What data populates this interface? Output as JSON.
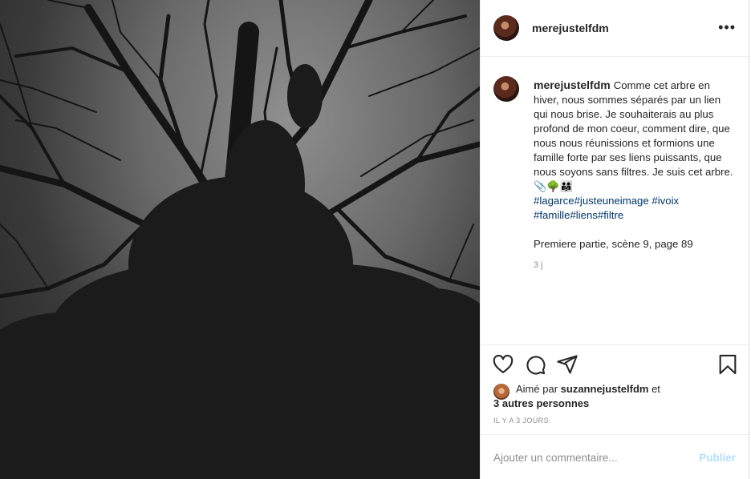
{
  "post": {
    "username": "merejustelfdm",
    "more_label": "•••"
  },
  "caption": {
    "username": "merejustelfdm",
    "text": "Comme cet arbre en hiver, nous sommes séparés par un lien qui nous brise. Je souhaiterais au plus profond de mon coeur, comment dire, que nous nous réunissions et formions une famille forte par ses liens puissants, que nous soyons sans filtres. Je suis cet arbre.📎🌳👨‍👩‍👧",
    "hashtags_line1": [
      "#lagarce",
      "#justeuneimage",
      "#ivoix"
    ],
    "hashtags_line2": [
      "#famille",
      "#liens",
      "#filtre"
    ],
    "scene": "Premiere partie, scène 9, page 89",
    "time": "3 j"
  },
  "actions": {
    "icons": [
      "heart-icon",
      "comment-icon",
      "share-icon",
      "bookmark-icon"
    ]
  },
  "likes": {
    "prefix": "Aimé par",
    "user": "suzannejustelfdm",
    "suffix": "et",
    "others": "3 autres personnes"
  },
  "date_label": "IL Y A 3 JOURS",
  "add_comment": {
    "placeholder": "Ajouter un commentaire...",
    "publish_label": "Publier"
  },
  "colors": {
    "hashtag": "#00376b",
    "publish": "#b2dffc",
    "muted": "#8e8e8e"
  }
}
